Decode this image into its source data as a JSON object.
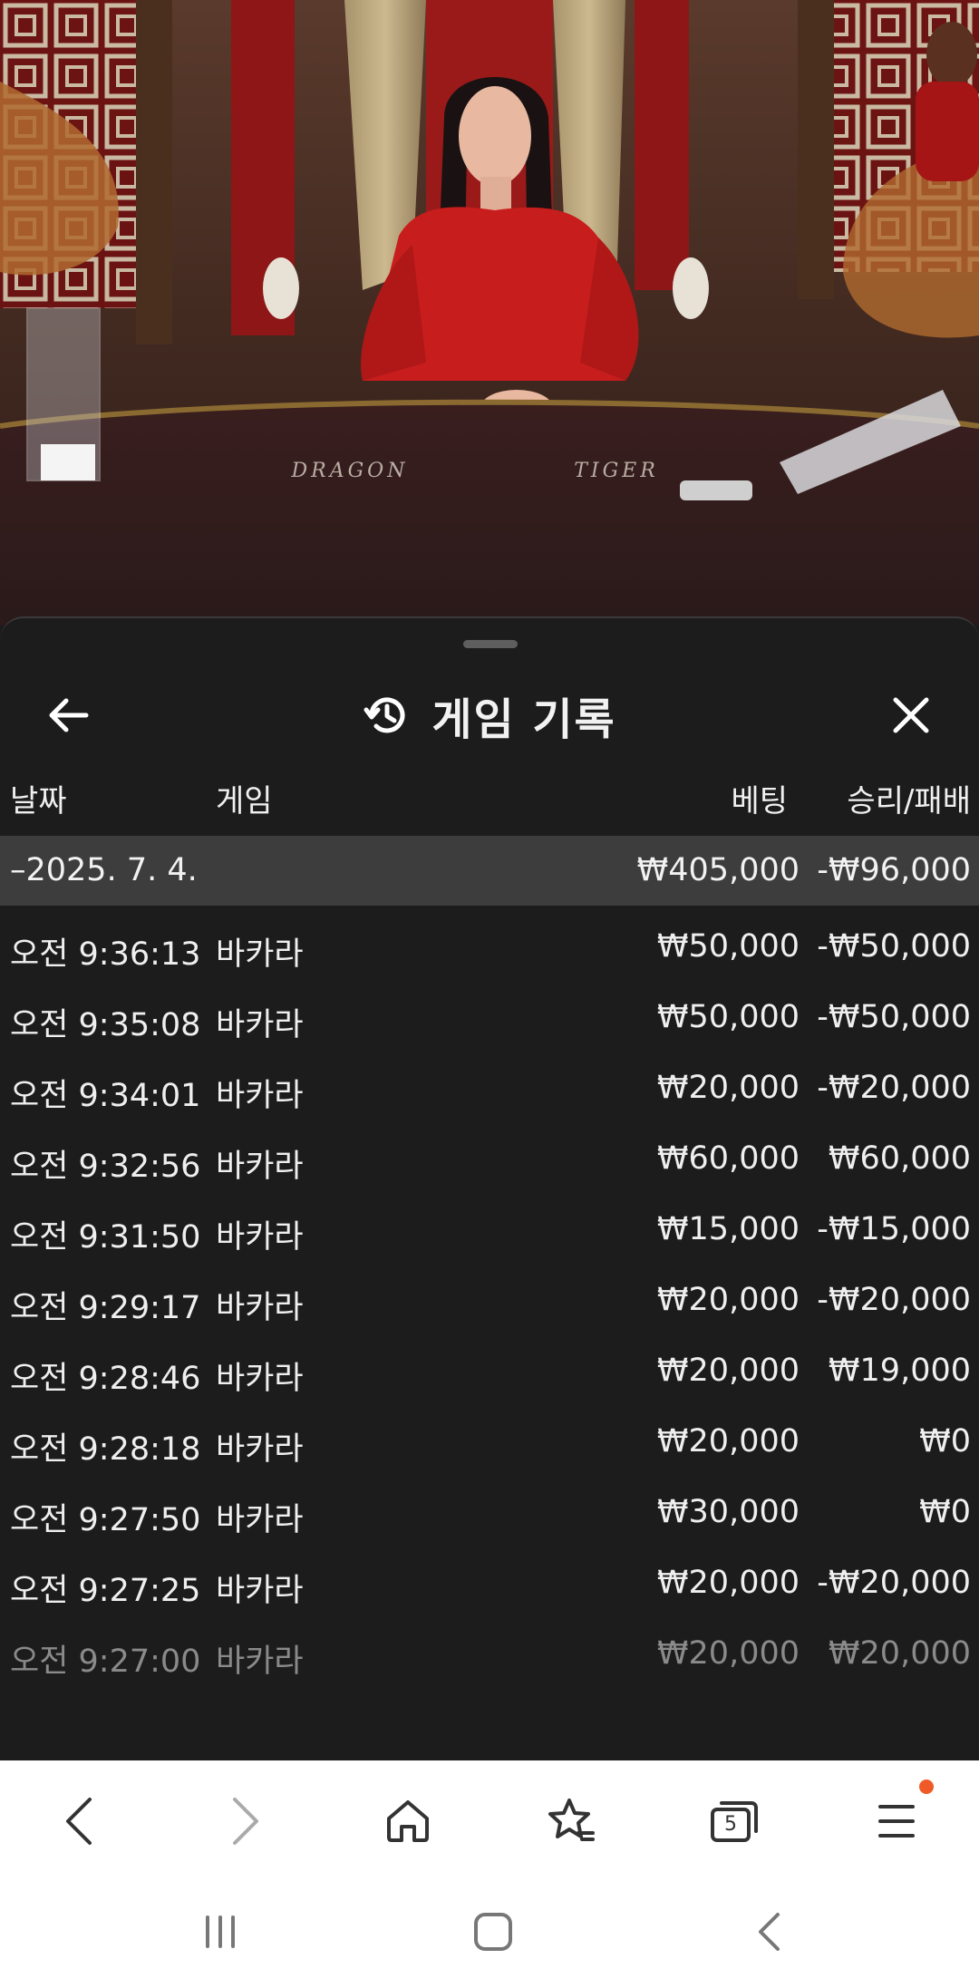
{
  "scene": {
    "table_labels": [
      "DRAGON",
      "TIGER"
    ]
  },
  "sheet": {
    "title": "게임 기록",
    "icons": {
      "back": "arrow-left-icon",
      "history": "history-icon",
      "close": "close-icon"
    }
  },
  "columns": {
    "date": "날짜",
    "game": "게임",
    "bet": "베팅",
    "result": "승리/패배"
  },
  "summary": {
    "date": "–2025. 7. 4.",
    "bet": "₩405,000",
    "result": "-₩96,000"
  },
  "rows": [
    {
      "time": "오전 9:36:13",
      "game": "바카라",
      "bet": "₩50,000",
      "result": "-₩50,000"
    },
    {
      "time": "오전 9:35:08",
      "game": "바카라",
      "bet": "₩50,000",
      "result": "-₩50,000"
    },
    {
      "time": "오전 9:34:01",
      "game": "바카라",
      "bet": "₩20,000",
      "result": "-₩20,000"
    },
    {
      "time": "오전 9:32:56",
      "game": "바카라",
      "bet": "₩60,000",
      "result": "₩60,000"
    },
    {
      "time": "오전 9:31:50",
      "game": "바카라",
      "bet": "₩15,000",
      "result": "-₩15,000"
    },
    {
      "time": "오전 9:29:17",
      "game": "바카라",
      "bet": "₩20,000",
      "result": "-₩20,000"
    },
    {
      "time": "오전 9:28:46",
      "game": "바카라",
      "bet": "₩20,000",
      "result": "₩19,000"
    },
    {
      "time": "오전 9:28:18",
      "game": "바카라",
      "bet": "₩20,000",
      "result": "₩0"
    },
    {
      "time": "오전 9:27:50",
      "game": "바카라",
      "bet": "₩30,000",
      "result": "₩0"
    },
    {
      "time": "오전 9:27:25",
      "game": "바카라",
      "bet": "₩20,000",
      "result": "-₩20,000"
    },
    {
      "time": "오전 9:27:00",
      "game": "바카라",
      "bet": "₩20,000",
      "result": "₩20,000"
    }
  ],
  "toolbar": {
    "tab_count": "5",
    "icons": [
      "back-arrow-icon",
      "forward-arrow-icon",
      "home-icon",
      "bookmarks-star-icon",
      "tabs-icon",
      "menu-icon"
    ],
    "notification_color": "#f05a28"
  },
  "system_nav": {
    "icons": [
      "recent-apps-icon",
      "home-button-icon",
      "back-button-icon"
    ]
  },
  "colors": {
    "sheet_bg": "#1c1c1c",
    "summary_bg": "#3d3d3d",
    "dress": "#c81d1d"
  }
}
